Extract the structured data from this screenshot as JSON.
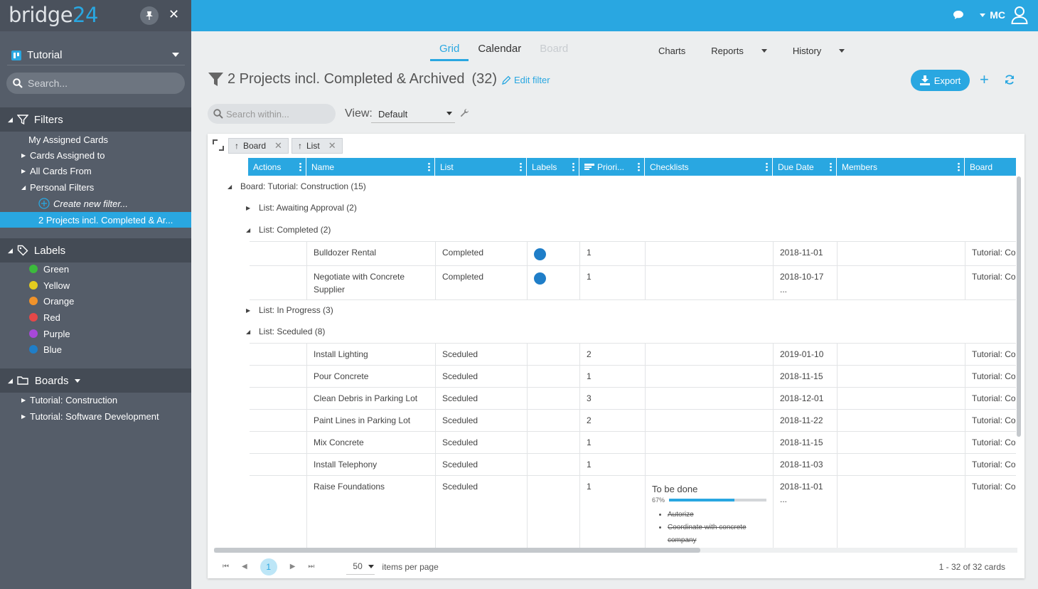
{
  "app": {
    "logo_text": "bridge",
    "logo_num": "24",
    "brand_color": "#29a7e1"
  },
  "sidebar": {
    "project": "Tutorial",
    "search_placeholder": "Search...",
    "filters": {
      "heading": "Filters",
      "items": [
        "My Assigned Cards",
        "Cards Assigned to",
        "All Cards From",
        "Personal Filters"
      ],
      "create_new": "Create new filter...",
      "active_filter": "2 Projects incl. Completed & Ar..."
    },
    "labels": {
      "heading": "Labels",
      "items": [
        {
          "name": "Green",
          "color": "#3cba3c"
        },
        {
          "name": "Yellow",
          "color": "#e4cc1e"
        },
        {
          "name": "Orange",
          "color": "#f0922a"
        },
        {
          "name": "Red",
          "color": "#e64848"
        },
        {
          "name": "Purple",
          "color": "#a748d8"
        },
        {
          "name": "Blue",
          "color": "#1f7ec8"
        }
      ]
    },
    "boards": {
      "heading": "Boards",
      "items": [
        "Tutorial: Construction",
        "Tutorial: Software Development"
      ]
    }
  },
  "topbar": {
    "user_initials": "MC"
  },
  "tabs": {
    "grid": "Grid",
    "calendar": "Calendar",
    "board": "Board",
    "charts": "Charts",
    "reports": "Reports",
    "history": "History"
  },
  "toolbar": {
    "title": "2 Projects incl. Completed & Archived",
    "count": "(32)",
    "edit_filter": "Edit filter",
    "export": "Export",
    "search_within_placeholder": "Search within...",
    "view_label": "View:",
    "view_value": "Default"
  },
  "grid": {
    "group_chips": [
      "Board",
      "List"
    ],
    "columns": [
      "Actions",
      "Name",
      "List",
      "Labels",
      "Priori...",
      "Checklists",
      "Due Date",
      "Members",
      "Board"
    ],
    "board_group": "Board: Tutorial: Construction (15)",
    "list_groups": [
      "List: Awaiting Approval (2)",
      "List: Completed (2)",
      "List: In Progress (3)",
      "List: Sceduled (8)"
    ],
    "completed_rows": [
      {
        "name": "Bulldozer Rental",
        "list": "Completed",
        "label": "Blue",
        "priority": "1",
        "due": "2018-11-01 ...",
        "board": "Tutorial: Con"
      },
      {
        "name": "Negotiate with Concrete Supplier",
        "list": "Completed",
        "label": "Blue",
        "priority": "1",
        "due": "2018-10-17 ...",
        "board": "Tutorial: Con"
      }
    ],
    "sceduled_rows": [
      {
        "name": "Install Lighting",
        "list": "Sceduled",
        "priority": "2",
        "due": "2019-01-10 ...",
        "board": "Tutorial: Con"
      },
      {
        "name": "Pour Concrete",
        "list": "Sceduled",
        "priority": "1",
        "due": "2018-11-15 ...",
        "board": "Tutorial: Con"
      },
      {
        "name": "Clean Debris in Parking Lot",
        "list": "Sceduled",
        "priority": "3",
        "due": "2018-12-01 ...",
        "board": "Tutorial: Con"
      },
      {
        "name": "Paint Lines in Parking Lot",
        "list": "Sceduled",
        "priority": "2",
        "due": "2018-11-22 ...",
        "board": "Tutorial: Con"
      },
      {
        "name": "Mix Concrete",
        "list": "Sceduled",
        "priority": "1",
        "due": "2018-11-15 ...",
        "board": "Tutorial: Con"
      },
      {
        "name": "Install Telephony",
        "list": "Sceduled",
        "priority": "1",
        "due": "2018-11-03 ...",
        "board": "Tutorial: Con"
      },
      {
        "name": "Raise Foundations",
        "list": "Sceduled",
        "priority": "1",
        "due": "2018-11-01 ...",
        "board": "Tutorial: Con"
      }
    ],
    "checklist": {
      "title": "To be done",
      "progress_text": "67%",
      "progress": 0.67,
      "items": [
        "Autorize",
        "Coordinate with concrete company"
      ]
    }
  },
  "pager": {
    "current_page": "1",
    "page_size": "50",
    "items_per_page": "items per page",
    "count": "1 - 32 of 32 cards"
  }
}
